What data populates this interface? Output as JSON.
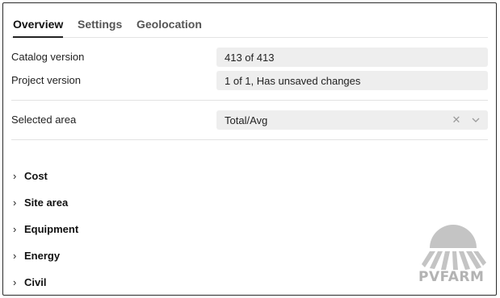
{
  "tabs": [
    {
      "label": "Overview",
      "active": true
    },
    {
      "label": "Settings",
      "active": false
    },
    {
      "label": "Geolocation",
      "active": false
    }
  ],
  "fields": {
    "catalog_version": {
      "label": "Catalog version",
      "value": "413 of 413"
    },
    "project_version": {
      "label": "Project version",
      "value": "1 of 1, Has unsaved changes"
    },
    "selected_area": {
      "label": "Selected area",
      "value": "Total/Avg",
      "clear_icon": "close-icon",
      "dropdown_icon": "chevron-down-icon"
    }
  },
  "sections": [
    "Cost",
    "Site area",
    "Equipment",
    "Energy",
    "Civil"
  ],
  "logo": {
    "text": "PVFARM",
    "color": "#b3b3b3"
  }
}
